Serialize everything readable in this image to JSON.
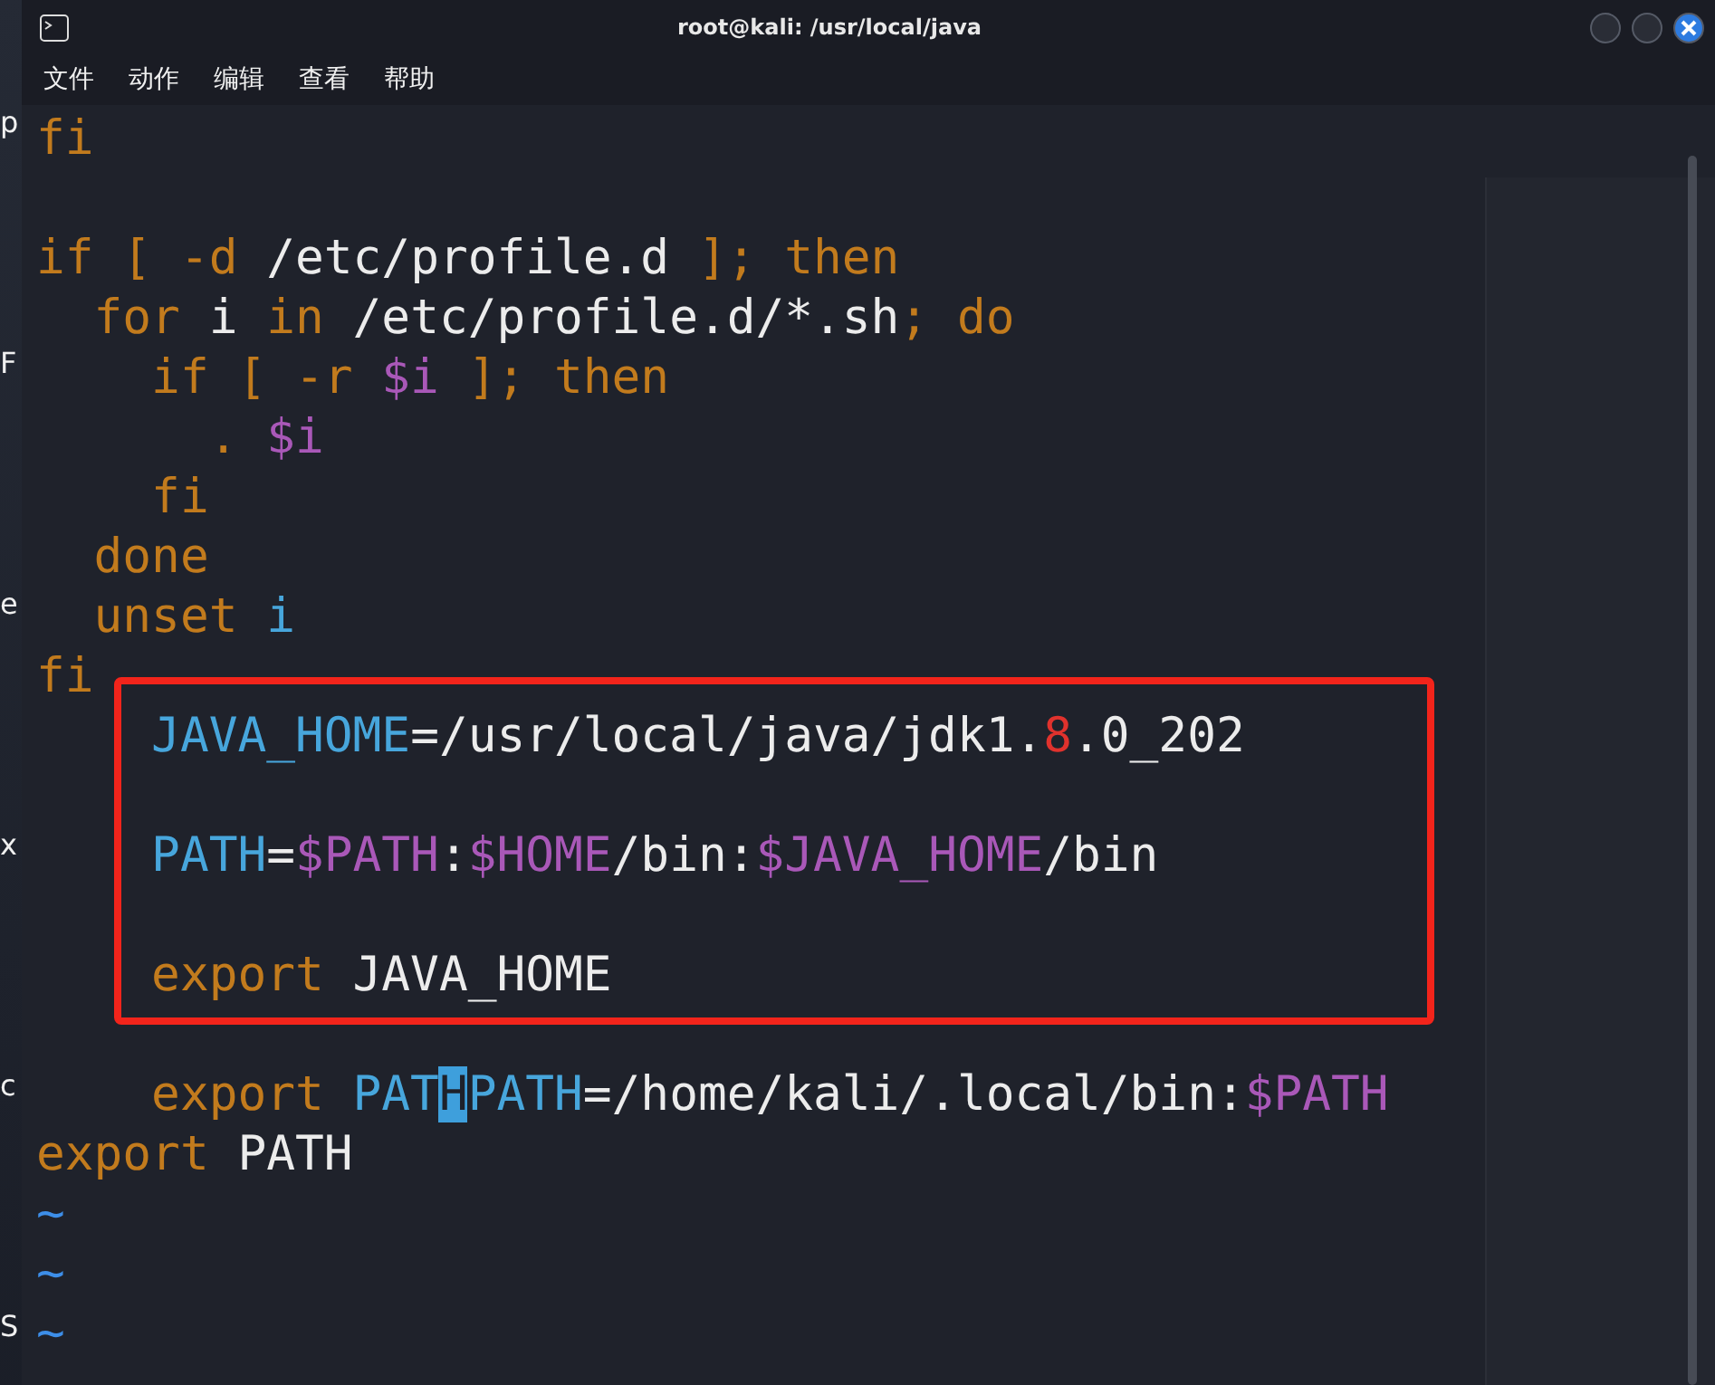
{
  "desktop": {
    "edge_labels": [
      "p",
      "F",
      "e",
      "x",
      "c",
      "S"
    ]
  },
  "window": {
    "title": "root@kali: /usr/local/java",
    "menu": [
      "文件",
      "动作",
      "编辑",
      "查看",
      "帮助"
    ]
  },
  "editor": {
    "lines": [
      {
        "kind": "code",
        "segments": [
          {
            "text": "fi",
            "kind": "keyword"
          }
        ]
      },
      {
        "kind": "blank"
      },
      {
        "kind": "code",
        "segments": [
          {
            "text": "if [ -d",
            "kind": "keyword"
          },
          {
            "text": " /etc/profile.d ",
            "kind": "plain"
          },
          {
            "text": "]; then",
            "kind": "keyword"
          }
        ]
      },
      {
        "kind": "code",
        "segments": [
          {
            "text": "  for",
            "kind": "keyword"
          },
          {
            "text": " i ",
            "kind": "plain"
          },
          {
            "text": "in",
            "kind": "keyword"
          },
          {
            "text": " /etc/profile.d/*.sh",
            "kind": "plain"
          },
          {
            "text": "; do",
            "kind": "keyword"
          }
        ]
      },
      {
        "kind": "code",
        "segments": [
          {
            "text": "    if [ -r",
            "kind": "keyword"
          },
          {
            "text": " $i",
            "kind": "variable"
          },
          {
            "text": " ]; then",
            "kind": "keyword"
          }
        ]
      },
      {
        "kind": "code",
        "segments": [
          {
            "text": "      .",
            "kind": "keyword"
          },
          {
            "text": " $i",
            "kind": "variable"
          }
        ]
      },
      {
        "kind": "code",
        "segments": [
          {
            "text": "    fi",
            "kind": "keyword"
          }
        ]
      },
      {
        "kind": "code",
        "segments": [
          {
            "text": "  done",
            "kind": "keyword"
          }
        ]
      },
      {
        "kind": "code",
        "segments": [
          {
            "text": "  unset",
            "kind": "keyword"
          },
          {
            "text": " i",
            "kind": "identifier"
          }
        ]
      },
      {
        "kind": "code",
        "segments": [
          {
            "text": "fi",
            "kind": "keyword"
          }
        ]
      },
      {
        "kind": "code",
        "segments": [
          {
            "text": "    JAVA_HOME",
            "kind": "identifier"
          },
          {
            "text": "=/usr/local/java/jdk1.",
            "kind": "plain"
          },
          {
            "text": "8",
            "kind": "number"
          },
          {
            "text": ".0_202",
            "kind": "plain"
          }
        ]
      },
      {
        "kind": "blank"
      },
      {
        "kind": "code",
        "segments": [
          {
            "text": "    PATH",
            "kind": "identifier"
          },
          {
            "text": "=",
            "kind": "plain"
          },
          {
            "text": "$PATH",
            "kind": "variable"
          },
          {
            "text": ":",
            "kind": "plain"
          },
          {
            "text": "$HOME",
            "kind": "variable"
          },
          {
            "text": "/bin:",
            "kind": "plain"
          },
          {
            "text": "$JAVA_HOME",
            "kind": "variable"
          },
          {
            "text": "/bin",
            "kind": "plain"
          }
        ]
      },
      {
        "kind": "blank"
      },
      {
        "kind": "code",
        "segments": [
          {
            "text": "    export",
            "kind": "keyword"
          },
          {
            "text": " JAVA_HOME",
            "kind": "plain"
          }
        ]
      },
      {
        "kind": "blank"
      },
      {
        "kind": "code",
        "segments": [
          {
            "text": "    export",
            "kind": "keyword"
          },
          {
            "text": " PAT",
            "kind": "identifier"
          },
          {
            "text": "H",
            "kind": "cursor"
          },
          {
            "text": "PATH",
            "kind": "identifier"
          },
          {
            "text": "=/home/kali/.local/bin:",
            "kind": "plain"
          },
          {
            "text": "$PATH",
            "kind": "variable"
          }
        ]
      },
      {
        "kind": "code",
        "segments": [
          {
            "text": "export",
            "kind": "keyword"
          },
          {
            "text": " PATH",
            "kind": "plain"
          }
        ]
      },
      {
        "kind": "code",
        "segments": [
          {
            "text": "~",
            "kind": "tilde"
          }
        ]
      },
      {
        "kind": "code",
        "segments": [
          {
            "text": "~",
            "kind": "tilde"
          }
        ]
      },
      {
        "kind": "code",
        "segments": [
          {
            "text": "~",
            "kind": "tilde"
          }
        ]
      }
    ]
  }
}
